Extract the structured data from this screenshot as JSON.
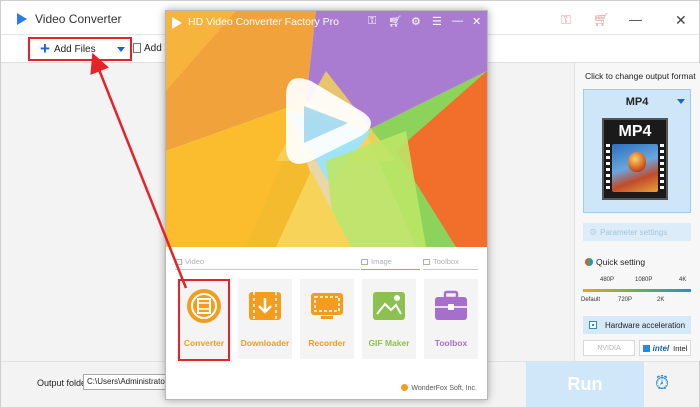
{
  "back_window": {
    "title": "Video Converter",
    "toolbar": {
      "add_files_label": "Add Files",
      "add_video_label": "Add V"
    },
    "right_panel": {
      "hint": "Click to change output format",
      "format": "MP4",
      "format_icon_text": "MP4",
      "parameter_settings": "Parameter settings",
      "quick_setting": "Quick setting",
      "slider_top_ticks": [
        "480P",
        "1080P",
        "4K"
      ],
      "slider_bottom_ticks": [
        "Default",
        "720P",
        "2K"
      ],
      "hardware_acceleration": "Hardware acceleration",
      "nvidia": "NVIDIA",
      "intel_logo": "intel",
      "intel": "Intel"
    },
    "bottom": {
      "output_label": "Output folder:",
      "output_path": "C:\\Users\\Administrator\\Desk",
      "run_label": "Run"
    }
  },
  "front_window": {
    "title": "HD Video Converter Factory Pro",
    "sections": {
      "video": "Video",
      "image": "Image",
      "toolbox": "Toolbox"
    },
    "tools": [
      {
        "label": "Converter",
        "color": "#f39c1d"
      },
      {
        "label": "Downloader",
        "color": "#f39c1d"
      },
      {
        "label": "Recorder",
        "color": "#f39c1d"
      },
      {
        "label": "GIF Maker",
        "color": "#8cc152"
      },
      {
        "label": "Toolbox",
        "color": "#a56fcb"
      }
    ],
    "footer": "WonderFox Soft, Inc."
  },
  "colors": {
    "accent_blue": "#2d8ad6",
    "highlight_red": "#e4232a",
    "run_button": "#cfe7f9"
  }
}
